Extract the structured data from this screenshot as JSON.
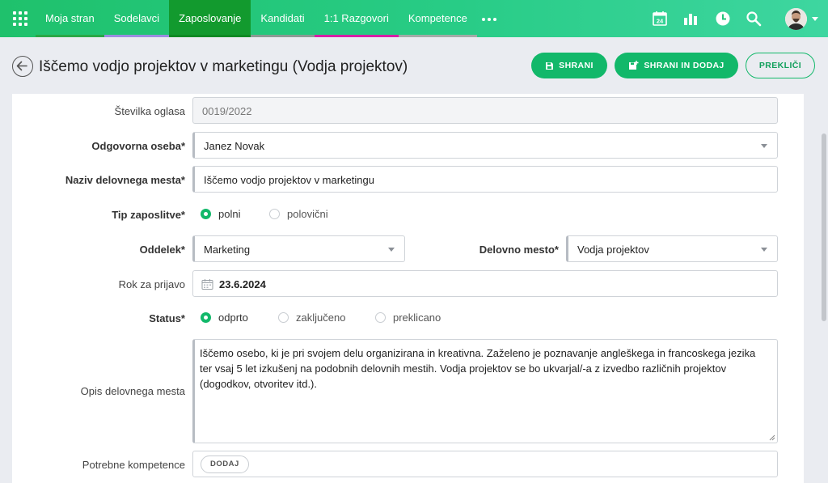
{
  "nav": {
    "items": [
      {
        "label": "Moja stran",
        "underline": "#2aa846"
      },
      {
        "label": "Sodelavci",
        "underline": "#9b8de0"
      },
      {
        "label": "Zaposlovanje",
        "underline": "#0e8a23"
      },
      {
        "label": "Kandidati",
        "underline": "#8c9a94"
      },
      {
        "label": "1:1 Razgovori",
        "underline": "#d61fa6"
      },
      {
        "label": "Kompetence",
        "underline": "#a3aba7"
      }
    ],
    "active_index": 2,
    "more_icon": "ellipsis-icon",
    "calendar_day": "24",
    "icons": [
      "apps-grid-icon",
      "calendar-icon",
      "bar-chart-icon",
      "clock-icon",
      "search-icon",
      "avatar",
      "chevron-down-icon"
    ]
  },
  "header": {
    "title": "Iščemo vodjo projektov v marketingu (Vodja projektov)",
    "save_label": "SHRANI",
    "save_add_label": "SHRANI IN DODAJ",
    "cancel_label": "PREKLIČI"
  },
  "form": {
    "ad_number": {
      "label": "Številka oglasa",
      "value": "0019/2022"
    },
    "responsible": {
      "label": "Odgovorna oseba*",
      "value": "Janez Novak"
    },
    "job_title": {
      "label": "Naziv delovnega mesta*",
      "value": "Iščemo vodjo projektov v marketingu"
    },
    "employment_type": {
      "label": "Tip zaposlitve*",
      "options": [
        "polni",
        "polovični"
      ],
      "selected": "polni"
    },
    "department": {
      "label": "Oddelek*",
      "value": "Marketing"
    },
    "position": {
      "label": "Delovno mesto*",
      "value": "Vodja projektov"
    },
    "deadline": {
      "label": "Rok za prijavo",
      "value": "23.6.2024"
    },
    "status": {
      "label": "Status*",
      "options": [
        "odprto",
        "zaključeno",
        "preklicano"
      ],
      "selected": "odprto"
    },
    "description": {
      "label": "Opis delovnega mesta",
      "value": "Iščemo osebo, ki je pri svojem delu organizirana in kreativna. Zaželeno je poznavanje angleškega in francoskega jezika ter vsaj 5 let izkušenj na podobnih delovnih mestih. Vodja projektov se bo ukvarjal/-a z izvedbo različnih projektov (dogodkov, otvoritev itd.)."
    },
    "competences": {
      "label": "Potrebne kompetence",
      "add_label": "DODAJ"
    }
  },
  "colors": {
    "accent": "#12b86a",
    "nav_active": "#129a2e",
    "background": "#eaecf1"
  }
}
